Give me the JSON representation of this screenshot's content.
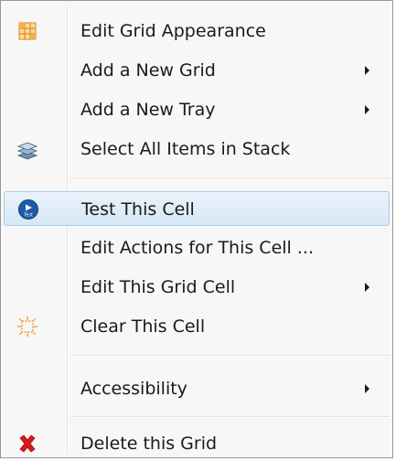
{
  "menu": {
    "items": [
      {
        "label": "Edit Grid Appearance"
      },
      {
        "label": "Add a New Grid"
      },
      {
        "label": "Add a New Tray"
      },
      {
        "label": "Select All Items in Stack"
      },
      {
        "label": "Test This Cell",
        "icon_text": "Test"
      },
      {
        "label": "Edit Actions for This Cell ..."
      },
      {
        "label": "Edit This Grid Cell"
      },
      {
        "label": "Clear This Cell"
      },
      {
        "label": "Accessibility"
      },
      {
        "label": "Delete this Grid"
      }
    ],
    "highlighted_item": "Test This Cell"
  },
  "icons": {
    "grid": "grid-appearance-icon",
    "stack": "stack-layers-icon",
    "test": "test-play-icon",
    "clear": "clear-cell-icon",
    "delete": "delete-x-icon"
  },
  "colors": {
    "menu_bg": "#f7f7f7",
    "highlight": "#d7e8f7",
    "test_icon": "#1e5aa8",
    "delete_icon": "#d81b1b",
    "grid_icon": "#f0a030"
  }
}
